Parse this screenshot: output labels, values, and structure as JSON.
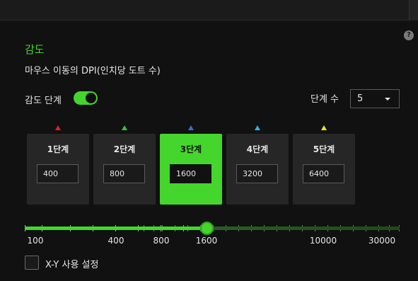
{
  "header": {
    "help_glyph": "?"
  },
  "section": {
    "title": "감도",
    "subtitle": "마우스 이동의 DPI(인치당 도트 수)"
  },
  "stages": {
    "label": "감도 단계",
    "enabled": true,
    "count_label": "단계 수",
    "count_value": "5",
    "active_index": 2,
    "items": [
      {
        "name": "1단계",
        "dpi": "400",
        "marker_color": "#e02020"
      },
      {
        "name": "2단계",
        "dpi": "800",
        "marker_color": "#2ec82e"
      },
      {
        "name": "3단계",
        "dpi": "1600",
        "marker_color": "#2a6fe0"
      },
      {
        "name": "4단계",
        "dpi": "3200",
        "marker_color": "#20b8e8"
      },
      {
        "name": "5단계",
        "dpi": "6400",
        "marker_color": "#f0e020"
      }
    ]
  },
  "slider": {
    "current_value": 1600,
    "scale_labels": [
      "100",
      "400",
      "800",
      "1600",
      "10000",
      "30000"
    ]
  },
  "xy": {
    "label": "X-Y 사용 설정",
    "checked": false
  },
  "colors": {
    "accent": "#44d62c",
    "background": "#111111",
    "card": "#262626"
  }
}
